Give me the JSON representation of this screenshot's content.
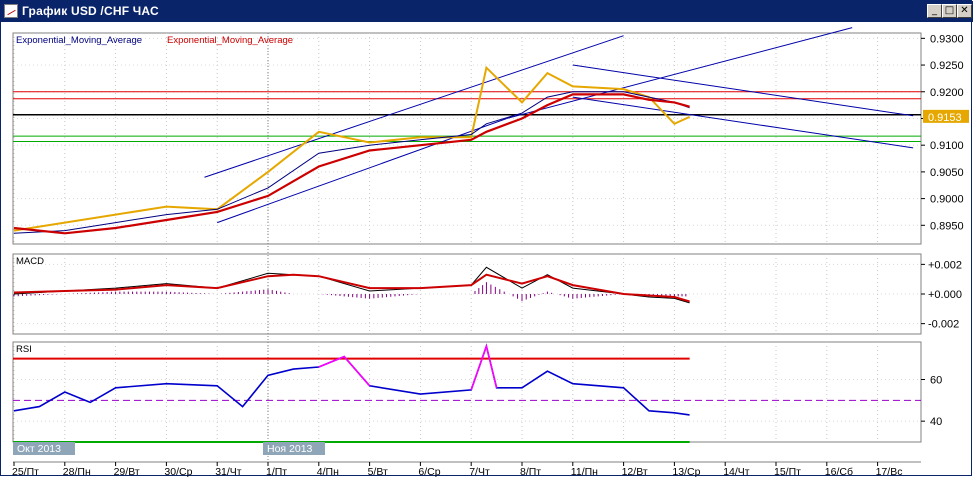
{
  "window": {
    "title": "График USD /CHF ЧАС",
    "buttons": [
      {
        "name": "minimize-button",
        "glyph": "_"
      },
      {
        "name": "maximize-button",
        "glyph": "□"
      },
      {
        "name": "close-button",
        "glyph": "✕"
      }
    ]
  },
  "colors": {
    "price": "#e6a800",
    "ema_fast": "#000080",
    "ema_slow": "#cc0000",
    "channel": "#0000aa",
    "hline_red": "#e00000",
    "hline_black": "#000000",
    "hline_green": "#00aa00",
    "macd_line": "#000000",
    "signal_line": "#cc0000",
    "histogram": "#800080",
    "rsi_line": "#0000cc",
    "rsi_overbought_segment": "#ff00ff",
    "price_badge": "#e6a800"
  },
  "chart_data": [
    {
      "type": "line",
      "panel": "price",
      "legend": [
        "Exponential_Moving_Average",
        "Exponential_Moving_Average"
      ],
      "yaxis_ticks": [
        "0.9300",
        "0.9250",
        "0.9200",
        "0.9150",
        "0.9100",
        "0.9050",
        "0.9000",
        "0.8950"
      ],
      "ylim": [
        0.8915,
        0.931
      ],
      "current_price_label": "0.9153",
      "current_price": 0.9153,
      "x_ticks": [
        "25/Пт",
        "28/Пн",
        "29/Вт",
        "30/Ср",
        "31/Чт",
        "1/Пт",
        "4/Пн",
        "5/Вт",
        "6/Ср",
        "7/Чт",
        "8/Пт",
        "11/Пн",
        "12/Вт",
        "13/Ср",
        "14/Чт",
        "15/Пт",
        "16/Сб",
        "17/Вс"
      ],
      "month_labels": [
        "Окт 2013",
        "Ноя 2013"
      ],
      "x": [
        0,
        1,
        2,
        3,
        4,
        5,
        6,
        7,
        8,
        9,
        9.3,
        10,
        10.5,
        11,
        12,
        12.5,
        13,
        13.3
      ],
      "series": [
        {
          "values": [
            0.894,
            0.8955,
            0.897,
            0.8985,
            0.898,
            0.905,
            0.9125,
            0.9105,
            0.9115,
            0.9115,
            0.9245,
            0.918,
            0.9235,
            0.921,
            0.9205,
            0.919,
            0.914,
            0.9153
          ]
        },
        {
          "values": [
            0.8935,
            0.894,
            0.8955,
            0.897,
            0.898,
            0.902,
            0.9085,
            0.91,
            0.911,
            0.912,
            0.914,
            0.916,
            0.919,
            0.92,
            0.92,
            0.919,
            0.918,
            0.917
          ]
        },
        {
          "values": [
            0.8945,
            0.8935,
            0.8945,
            0.896,
            0.8975,
            0.9005,
            0.906,
            0.909,
            0.91,
            0.911,
            0.9125,
            0.915,
            0.9175,
            0.9195,
            0.9195,
            0.9185,
            0.918,
            0.9172
          ]
        }
      ],
      "horizontal_levels": [
        {
          "value": 0.92,
          "color_key": "hline_red"
        },
        {
          "value": 0.9187,
          "color_key": "hline_red"
        },
        {
          "value": 0.9157,
          "color_key": "hline_black"
        },
        {
          "value": 0.9117,
          "color_key": "hline_green"
        },
        {
          "value": 0.9107,
          "color_key": "hline_green"
        }
      ]
    },
    {
      "type": "line",
      "panel": "macd",
      "legend": [
        "MACD"
      ],
      "yaxis_ticks": [
        "+0.002",
        "+0.000",
        "-0.002"
      ],
      "ylim": [
        -0.0027,
        0.0027
      ],
      "x": [
        0,
        1,
        2,
        3,
        4,
        5,
        5.5,
        6,
        7,
        8,
        9,
        9.3,
        10,
        10.5,
        11,
        12,
        12.5,
        13,
        13.3
      ],
      "series": [
        {
          "values": [
            0.0,
            0.0002,
            0.0004,
            0.0007,
            0.0004,
            0.0014,
            0.0013,
            0.0012,
            0.0002,
            0.0004,
            0.0006,
            0.0018,
            0.0004,
            0.0013,
            0.0004,
            0.0,
            -0.0002,
            -0.0003,
            -0.0006
          ]
        },
        {
          "values": [
            0.0001,
            0.0002,
            0.0003,
            0.0006,
            0.0004,
            0.0012,
            0.0013,
            0.0012,
            0.0004,
            0.0004,
            0.0006,
            0.0013,
            0.0007,
            0.0012,
            0.0006,
            0.0,
            -0.0001,
            -0.0002,
            -0.0005
          ]
        }
      ]
    },
    {
      "type": "line",
      "panel": "rsi",
      "legend": [
        "RSI"
      ],
      "yaxis_ticks": [
        "60",
        "40"
      ],
      "ylim": [
        30,
        78
      ],
      "levels": [
        70,
        50,
        30
      ],
      "x": [
        0,
        0.5,
        1,
        1.5,
        2,
        3,
        4,
        4.5,
        5,
        5.5,
        6,
        6.5,
        7,
        8,
        9,
        9.3,
        9.5,
        10,
        10.5,
        11,
        12,
        12.5,
        13,
        13.3
      ],
      "values": [
        45,
        47,
        54,
        49,
        56,
        58,
        57,
        47,
        62,
        65,
        66,
        71,
        57,
        53,
        55,
        76,
        56,
        56,
        64,
        58,
        56,
        45,
        44,
        43
      ]
    }
  ]
}
